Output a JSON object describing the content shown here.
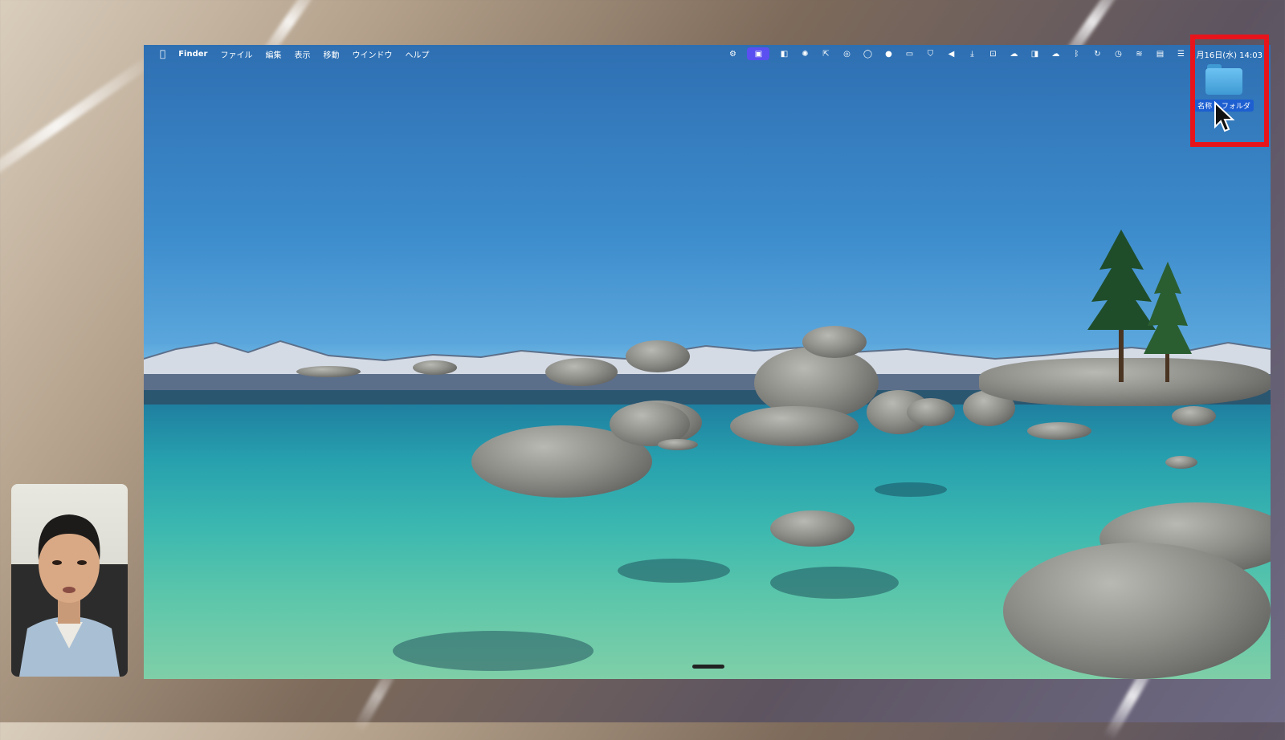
{
  "menubar": {
    "apple_icon": "apple-logo-icon",
    "items": [
      "Finder",
      "ファイル",
      "編集",
      "表示",
      "移動",
      "ウインドウ",
      "ヘルプ"
    ],
    "status_icons": [
      "gear-icon",
      "screen-record-icon",
      "app-icon",
      "settings-icon",
      "share-icon",
      "chat-icon",
      "whatsapp-icon",
      "message-icon",
      "display-icon",
      "shield-icon",
      "megaphone-icon",
      "download-icon",
      "download-box-icon",
      "cloud-icon",
      "sidebar-icon",
      "cloud-outline-icon",
      "bluetooth-icon",
      "rotate-icon",
      "clock-icon",
      "wifi-icon",
      "airplay-icon",
      "control-center-icon"
    ],
    "clock": "月16日(水) 14:03"
  },
  "desktop": {
    "folder_label": "名称未設定フォルダ",
    "folder_label_visible": "名称　 フォルダ"
  },
  "colors": {
    "highlight": "#e8141b",
    "menu_active": "#5a4ff0",
    "folder_label_bg": "#1d5fd1"
  }
}
